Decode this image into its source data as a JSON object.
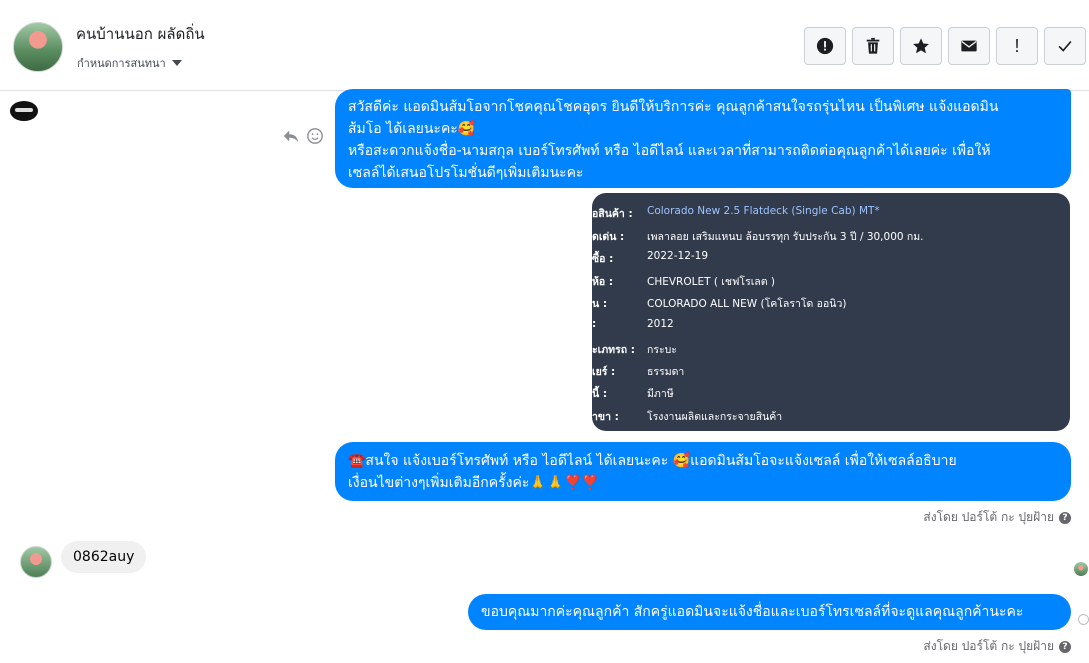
{
  "header": {
    "contact_name": "คนบ้านนอก ผลัดถิ่น",
    "assign_label": "กำหนดการสนทนา"
  },
  "toolbar": {
    "buttons": [
      {
        "icon": "alert-circle-icon"
      },
      {
        "icon": "trash-icon"
      },
      {
        "icon": "star-icon"
      },
      {
        "icon": "envelope-icon"
      },
      {
        "icon": "exclamation-icon",
        "label": "!"
      },
      {
        "icon": "check-icon"
      }
    ]
  },
  "messages": {
    "m1_line1": "สวัสดีค่ะ แอดมินส้มโอจากโชคคุณโชคอุดร ยินดีให้บริการค่ะ   คุณลูกค้าสนใจรถรุ่นไหน เป็นพิเศษ แจ้งแอดมิน",
    "m1_line2": "ส้มโอ ได้เลยนะคะ🥰",
    "m1_line3": "หรือสะดวกแจ้งชื่อ-นามสกุล เบอร์โทรศัพท์ หรือ ไอดีไลน์ และเวลาที่สามารถติดต่อคุณลูกค้าได้เลยค่ะ เพื่อให้",
    "m1_line4": "เซลล์ได้เสนอโปรโมชั่นดีๆเพิ่มเติมนะคะ",
    "m3_line1": "☎️สนใจ แจ้งเบอร์โทรศัพท์ หรือ ไอดีไลน์  ได้เลยนะคะ 🥰แอดมินส้มโอจะแจ้งเซลล์     เพื่อให้เซลล์อธิบาย",
    "m3_line2": "เงื่อนไขต่างๆเพิ่มเติมอีกครั้งค่ะ🙏🙏❣️❣️",
    "incoming": "0862auy",
    "m4": "ขอบคุณมากค่ะคุณลูกค้า สักครู่แอดมินจะแจ้งชื่อและเบอร์โทรเซลล์ที่จะดูแลคุณลูกค้านะคะ",
    "sent_by_1": "ส่งโดย ปอร์โต้ กะ ปุยฝ้าย",
    "sent_by_2": "ส่งโดย ปอร์โต้ กะ ปุยฝ้าย"
  },
  "card": {
    "rows": [
      {
        "k": "อสินค้า :",
        "v": "Colorado New 2.5 Flatdeck (Single Cab) MT*",
        "link": true
      },
      {
        "k": "ดเด่น :",
        "v": "เพลาลอย เสริมแหนบ ล้อบรรทุก รับประกัน 3 ปี / 30,000 กม."
      },
      {
        "k": "ซื้อ :",
        "v": "2022-12-19"
      },
      {
        "k": "ห้อ :",
        "v": "CHEVROLET ( เชฟโรเลต )"
      },
      {
        "k": "น :",
        "v": "COLORADO ALL NEW (โคโลราโด ออนิว)"
      },
      {
        "k": ":",
        "v": "2012"
      },
      {
        "k": "ะเภทรถ :",
        "v": "กระบะ"
      },
      {
        "k": "เยร์ :",
        "v": "ธรรมดา"
      },
      {
        "k": "นี้ :",
        "v": "มีภาษี"
      },
      {
        "k": "าขา :",
        "v": "โรงงานผลิตและกระจายสินค้า"
      }
    ]
  }
}
